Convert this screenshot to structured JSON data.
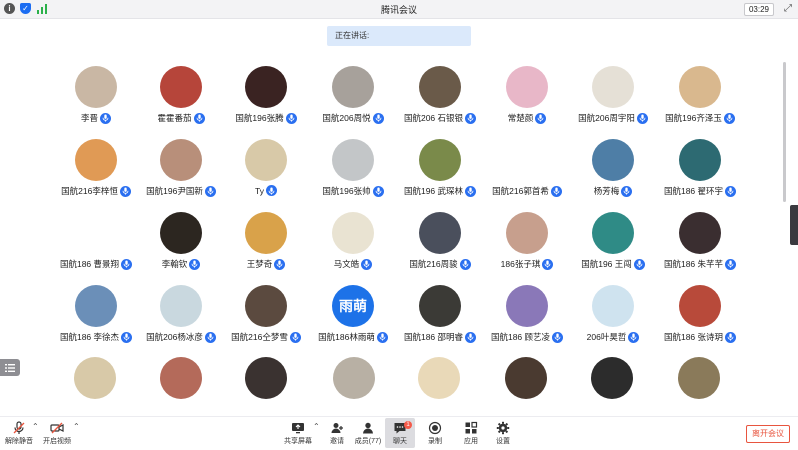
{
  "window": {
    "title": "腾讯会议",
    "timer": "03:29"
  },
  "speaking": {
    "label": "正在讲话:"
  },
  "participants": [
    {
      "name": "李晋",
      "bg": "#c9b7a4",
      "text": ""
    },
    {
      "name": "霍霍番茄",
      "bg": "#b6453a",
      "text": ""
    },
    {
      "name": "国航196张腾",
      "bg": "#3a2322",
      "text": ""
    },
    {
      "name": "国航206周悦",
      "bg": "#a7a19b",
      "text": ""
    },
    {
      "name": "国航206 石银银",
      "bg": "#6a5a49",
      "text": ""
    },
    {
      "name": "常楚颜",
      "bg": "#e8b7c8",
      "text": ""
    },
    {
      "name": "国航206周宇阳",
      "bg": "#e5e0d6",
      "text": ""
    },
    {
      "name": "国航196齐泽玉",
      "bg": "#d9b88e",
      "text": ""
    },
    {
      "name": "国航216李梓恒",
      "bg": "#e09a55",
      "text": ""
    },
    {
      "name": "国航196尹国新",
      "bg": "#b88f7a",
      "text": ""
    },
    {
      "name": "Ty",
      "bg": "#d8c9a8",
      "text": ""
    },
    {
      "name": "国航196张帅",
      "bg": "#c3c6c8",
      "text": ""
    },
    {
      "name": "国航196 武琛林",
      "bg": "#7a8a4a",
      "text": ""
    },
    {
      "name": "国航216郭首希",
      "bg": "#ffffff",
      "text": ""
    },
    {
      "name": "杨芳梅",
      "bg": "#4e7ea6",
      "text": ""
    },
    {
      "name": "国航186 翟环宇",
      "bg": "#2d6a72",
      "text": ""
    },
    {
      "name": "国航186 曹景翔",
      "bg": "#ffffff",
      "text": ""
    },
    {
      "name": "李翰钦",
      "bg": "#2c2620",
      "text": ""
    },
    {
      "name": "王梦奇",
      "bg": "#d9a24a",
      "text": ""
    },
    {
      "name": "马文皓",
      "bg": "#e9e3d2",
      "text": ""
    },
    {
      "name": "国航216周骏",
      "bg": "#4a4f5c",
      "text": ""
    },
    {
      "name": "186张子琪",
      "bg": "#c79f8d",
      "text": ""
    },
    {
      "name": "国航196 王闯",
      "bg": "#2f8b86",
      "text": ""
    },
    {
      "name": "国航186 朱芊芊",
      "bg": "#3a2e30",
      "text": ""
    },
    {
      "name": "国航186 李徐杰",
      "bg": "#6b8fb8",
      "text": ""
    },
    {
      "name": "国航206杨冰彦",
      "bg": "#c9d8df",
      "text": ""
    },
    {
      "name": "国航216仝梦雪",
      "bg": "#5b4a3f",
      "text": ""
    },
    {
      "name": "国航186林雨萌",
      "bg": "#1d72e8",
      "text": "雨萌"
    },
    {
      "name": "国航186 邵明睿",
      "bg": "#3b3a36",
      "text": ""
    },
    {
      "name": "国航186 顾艺凌",
      "bg": "#8a78b8",
      "text": ""
    },
    {
      "name": "206叶昊哲",
      "bg": "#cfe3ef",
      "text": ""
    },
    {
      "name": "国航186 张诗玥",
      "bg": "#b84a3a",
      "text": ""
    }
  ],
  "partial_row_colors": [
    "#d8c9a8",
    "#b46a5a",
    "#3a3230",
    "#b8b0a4",
    "#e9d9b8",
    "#4a3a30",
    "#2c2c2c",
    "#8a7a5a",
    "#c85a4a"
  ],
  "toolbar": {
    "unmute": "解除静音",
    "video": "开启视频",
    "share": "共享屏幕",
    "invite": "邀请",
    "members": "成员(77)",
    "chat": "聊天",
    "record": "录制",
    "apps": "应用",
    "settings": "设置",
    "leave": "离开会议",
    "chat_badge": "1"
  },
  "colors": {
    "accent": "#2a6ff0",
    "leave": "#e8553f"
  }
}
